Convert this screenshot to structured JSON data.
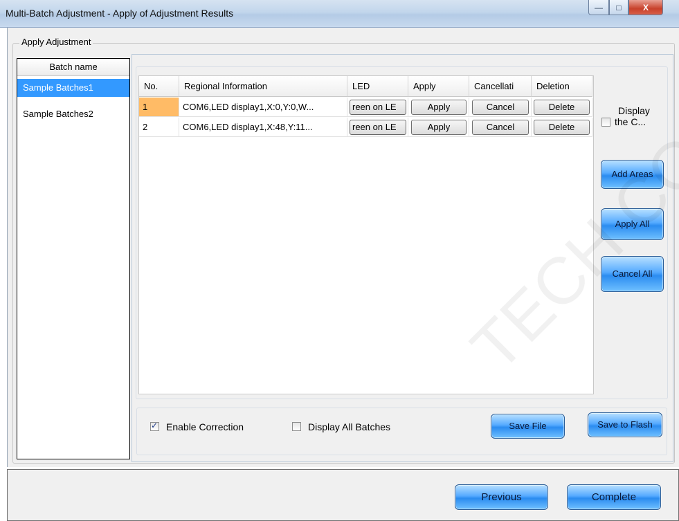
{
  "window": {
    "title": "Multi-Batch Adjustment - Apply of Adjustment Results",
    "controls": [
      "minimize",
      "maximize",
      "close"
    ],
    "close_glyph": "X",
    "min_glyph": "—",
    "max_glyph": "□"
  },
  "group": {
    "label": "Apply Adjustment"
  },
  "batches": {
    "header": "Batch name",
    "items": [
      {
        "label": "Sample Batches1",
        "selected": true
      },
      {
        "label": "Sample Batches2",
        "selected": false
      }
    ]
  },
  "table": {
    "columns": [
      "No.",
      "Regional Information",
      "LED",
      "Apply",
      "Cancellati",
      "Deletion"
    ],
    "rows": [
      {
        "no": "1",
        "info": "COM6,LED display1,X:0,Y:0,W...",
        "led": "reen on LE",
        "apply": "Apply",
        "cancel": "Cancel",
        "delete": "Delete",
        "selected": true
      },
      {
        "no": "2",
        "info": "COM6,LED display1,X:48,Y:11...",
        "led": "reen on LE",
        "apply": "Apply",
        "cancel": "Cancel",
        "delete": "Delete",
        "selected": false
      }
    ]
  },
  "side": {
    "display_label_1": "Display",
    "display_label_2": "the C...",
    "display_checked": false,
    "add_areas": "Add Areas",
    "apply_all": "Apply All",
    "cancel_all": "Cancel All"
  },
  "options": {
    "enable_correction": "Enable Correction",
    "enable_correction_checked": true,
    "display_all_batches": "Display All Batches",
    "display_all_batches_checked": false,
    "save_file": "Save File",
    "save_to_flash": "Save to Flash"
  },
  "footer": {
    "previous": "Previous",
    "complete": "Complete"
  },
  "watermark": "TECH CO., LTD",
  "colors": {
    "selection_blue": "#3399ff",
    "row_highlight": "#ffbb66",
    "button_blue": "#2b8cf0"
  }
}
